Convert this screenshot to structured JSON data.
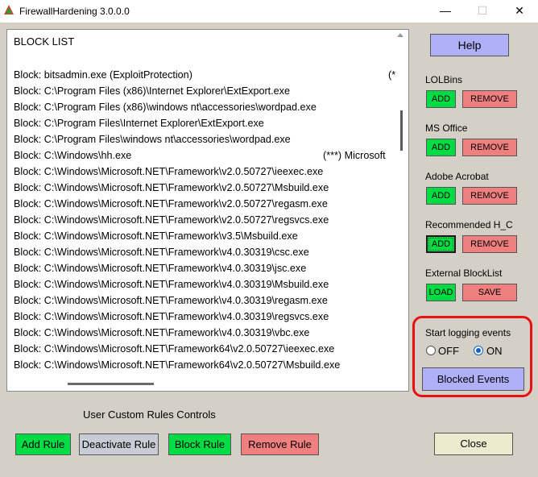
{
  "window": {
    "title": "FirewallHardening 3.0.0.0",
    "min_glyph": "—",
    "max_glyph": "☐",
    "close_glyph": "✕"
  },
  "block_list": {
    "header": "BLOCK LIST",
    "lines": [
      {
        "text": "Block: bitsadmin.exe (ExploitProtection)",
        "extra": "(*"
      },
      {
        "text": "Block: C:\\Program Files (x86)\\Internet Explorer\\ExtExport.exe",
        "extra": ""
      },
      {
        "text": "Block: C:\\Program Files (x86)\\windows nt\\accessories\\wordpad.exe",
        "extra": ""
      },
      {
        "text": "Block: C:\\Program Files\\Internet Explorer\\ExtExport.exe",
        "extra": ""
      },
      {
        "text": "Block: C:\\Program Files\\windows nt\\accessories\\wordpad.exe",
        "extra": ""
      },
      {
        "text": "Block: C:\\Windows\\hh.exe",
        "extra": "(***)  Microsoft"
      },
      {
        "text": "Block: C:\\Windows\\Microsoft.NET\\Framework\\v2.0.50727\\ieexec.exe",
        "extra": ""
      },
      {
        "text": "Block: C:\\Windows\\Microsoft.NET\\Framework\\v2.0.50727\\Msbuild.exe",
        "extra": ""
      },
      {
        "text": "Block: C:\\Windows\\Microsoft.NET\\Framework\\v2.0.50727\\regasm.exe",
        "extra": ""
      },
      {
        "text": "Block: C:\\Windows\\Microsoft.NET\\Framework\\v2.0.50727\\regsvcs.exe",
        "extra": ""
      },
      {
        "text": "Block: C:\\Windows\\Microsoft.NET\\Framework\\v3.5\\Msbuild.exe",
        "extra": ""
      },
      {
        "text": "Block: C:\\Windows\\Microsoft.NET\\Framework\\v4.0.30319\\csc.exe",
        "extra": ""
      },
      {
        "text": "Block: C:\\Windows\\Microsoft.NET\\Framework\\v4.0.30319\\jsc.exe",
        "extra": ""
      },
      {
        "text": "Block: C:\\Windows\\Microsoft.NET\\Framework\\v4.0.30319\\Msbuild.exe",
        "extra": ""
      },
      {
        "text": "Block: C:\\Windows\\Microsoft.NET\\Framework\\v4.0.30319\\regasm.exe",
        "extra": ""
      },
      {
        "text": "Block: C:\\Windows\\Microsoft.NET\\Framework\\v4.0.30319\\regsvcs.exe",
        "extra": ""
      },
      {
        "text": "Block: C:\\Windows\\Microsoft.NET\\Framework\\v4.0.30319\\vbc.exe",
        "extra": ""
      },
      {
        "text": "Block: C:\\Windows\\Microsoft.NET\\Framework64\\v2.0.50727\\ieexec.exe",
        "extra": ""
      },
      {
        "text": "Block: C:\\Windows\\Microsoft.NET\\Framework64\\v2.0.50727\\Msbuild.exe",
        "extra": ""
      }
    ]
  },
  "help_label": "Help",
  "groups": {
    "lolbins": {
      "label": "LOLBins",
      "add": "ADD",
      "remove": "REMOVE"
    },
    "ms_office": {
      "label": "MS Office",
      "add": "ADD",
      "remove": "REMOVE"
    },
    "adobe": {
      "label": "Adobe Acrobat",
      "add": "ADD",
      "remove": "REMOVE"
    },
    "recommended": {
      "label": "Recommended H_C",
      "add": "ADD",
      "remove": "REMOVE"
    },
    "external": {
      "label": "External BlockList",
      "load": "LOAD",
      "save": "SAVE"
    }
  },
  "logging": {
    "label": "Start logging events",
    "off_label": "OFF",
    "on_label": "ON",
    "selected": "ON",
    "blocked_events_label": "Blocked Events"
  },
  "custom_rules": {
    "label": "User Custom Rules Controls",
    "add_rule": "Add Rule",
    "deactivate_rule": "Deactivate Rule",
    "block_rule": "Block Rule",
    "remove_rule": "Remove Rule"
  },
  "close_label": "Close",
  "colors": {
    "add_green": "#00dd44",
    "remove_red": "#f08080",
    "help_blue": "#b0b0f8",
    "highlight_red": "#e81010"
  }
}
